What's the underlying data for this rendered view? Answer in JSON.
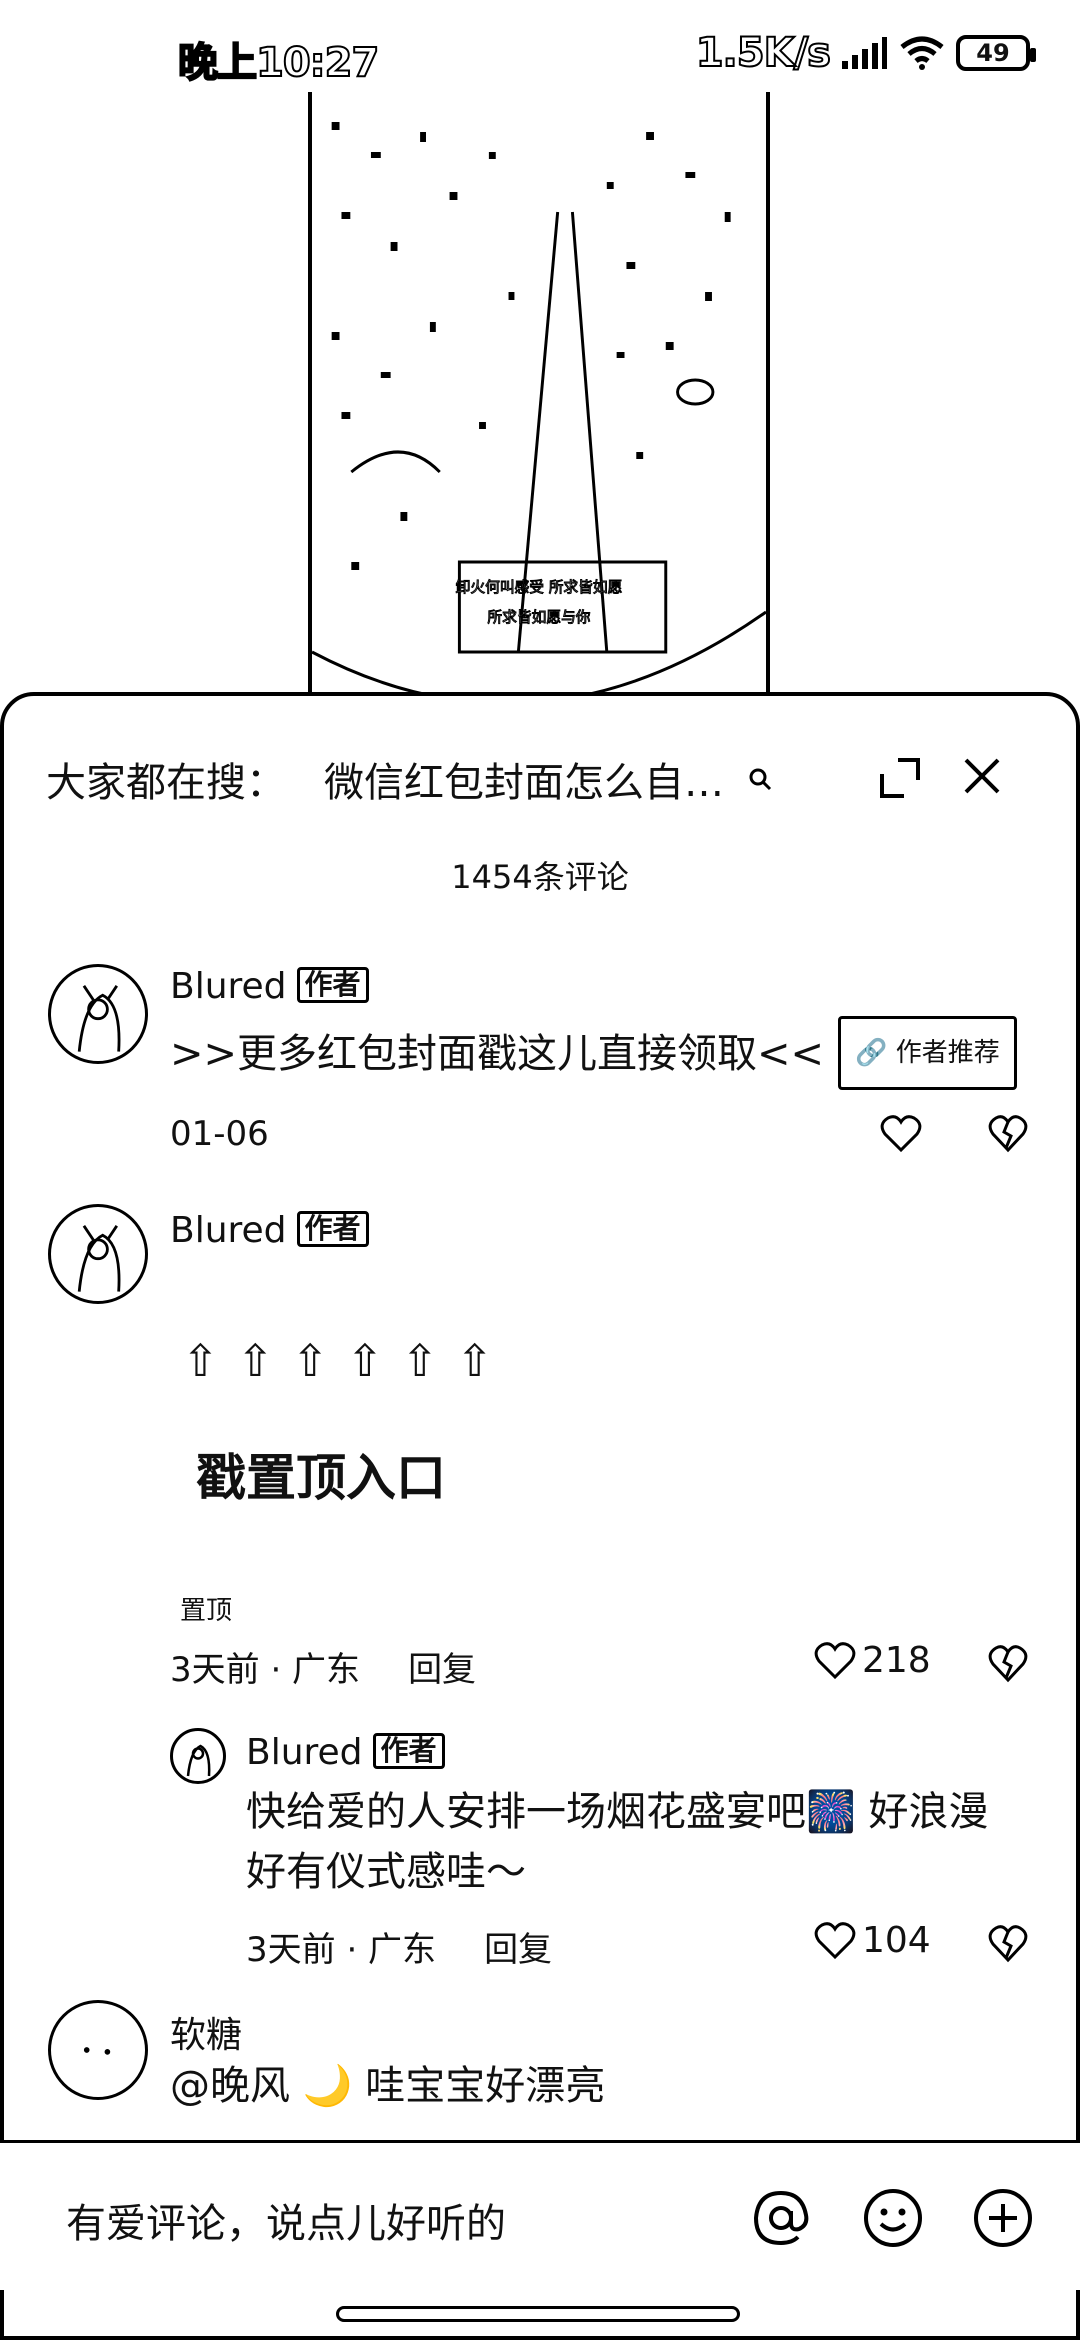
{
  "status_bar": {
    "time": "晚上10:27",
    "net_speed": "1.5K/s",
    "battery": "49"
  },
  "video": {
    "caption_line1": "卸火何叫感受 所求皆如愿",
    "caption_line2": "所求皆如愿与你"
  },
  "header": {
    "search_prefix": "大家都在搜：",
    "search_term": "微信红包封面怎么自…",
    "comment_count": "1454条评论"
  },
  "comments": [
    {
      "username": "Blured",
      "badge": "作者",
      "text": ">>更多红包封面戳这儿直接领取<<",
      "pill": "🔗 作者推荐",
      "date": "01-06"
    },
    {
      "username": "Blured",
      "badge": "作者",
      "arrows": "⇧ ⇧ ⇧ ⇧ ⇧ ⇧",
      "title": "戳置顶入口",
      "pinned": "置顶",
      "time_location": "3天前 · 广东",
      "reply": "回复",
      "likes": "218"
    },
    {
      "username": "Blured",
      "badge": "作者",
      "text_line1": "快给爱的人安排一场烟花盛宴吧🎆 好浪漫",
      "text_line2": "好有仪式感哇～",
      "time_location": "3天前 · 广东",
      "reply": "回复",
      "likes": "104"
    },
    {
      "username": "软糖",
      "text": "@晚风 🌙 哇宝宝好漂亮"
    }
  ],
  "input_bar": {
    "placeholder": "有爱评论，说点儿好听的"
  },
  "icons": {
    "search": "search-icon",
    "expand": "expand-icon",
    "close": "close-icon",
    "like": "heart-icon",
    "dislike": "broken-heart-icon",
    "mention": "at-icon",
    "emoji": "emoji-icon",
    "add": "plus-icon"
  }
}
